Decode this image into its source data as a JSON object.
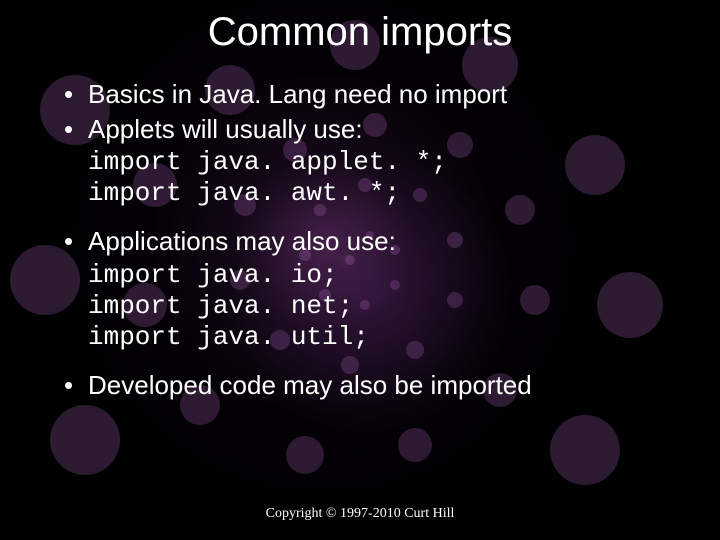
{
  "title": "Common imports",
  "bullets": {
    "basics": "Basics in Java. Lang need no import",
    "applets_intro": "Applets will usually use:",
    "applets_code": "import java. applet. *;\nimport java. awt. *;",
    "apps_intro": "Applications may also use:",
    "apps_code": "import java. io;\nimport java. net;\nimport java. util;",
    "developed": "Developed code may also be imported"
  },
  "footer": "Copyright © 1997-2010 Curt Hill"
}
